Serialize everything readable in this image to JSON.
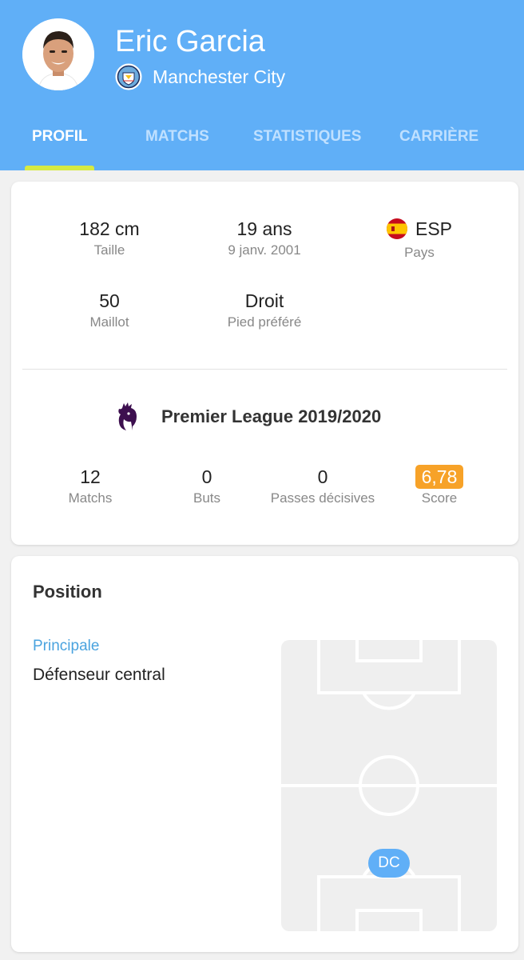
{
  "header": {
    "player_name": "Eric Garcia",
    "club_name": "Manchester City",
    "club_logo_icon": "manchester-city-crest-icon",
    "avatar_icon": "player-photo-avatar",
    "background_color": "#60aff7"
  },
  "tabs": [
    {
      "label": "PROFIL",
      "active": true
    },
    {
      "label": "MATCHS",
      "active": false
    },
    {
      "label": "STATISTIQUES",
      "active": false
    },
    {
      "label": "CARRIÈRE",
      "active": false
    }
  ],
  "profile": {
    "height": {
      "value": "182 cm",
      "label": "Taille"
    },
    "age": {
      "value": "19 ans",
      "label": "9 janv. 2001"
    },
    "country": {
      "value": "ESP",
      "label": "Pays",
      "flag_icon": "spain-flag-icon"
    },
    "shirt": {
      "value": "50",
      "label": "Maillot"
    },
    "foot": {
      "value": "Droit",
      "label": "Pied préféré"
    }
  },
  "league": {
    "title": "Premier League 2019/2020",
    "logo_icon": "premier-league-lion-icon",
    "stats": [
      {
        "value": "12",
        "label": "Matchs"
      },
      {
        "value": "0",
        "label": "Buts"
      },
      {
        "value": "0",
        "label": "Passes décisives"
      },
      {
        "value": "6,78",
        "label": "Score",
        "badge_color": "#f7a228"
      }
    ]
  },
  "position": {
    "title": "Position",
    "primary_label": "Principale",
    "primary_value": "Défenseur central",
    "pitch_marker": "DC"
  }
}
